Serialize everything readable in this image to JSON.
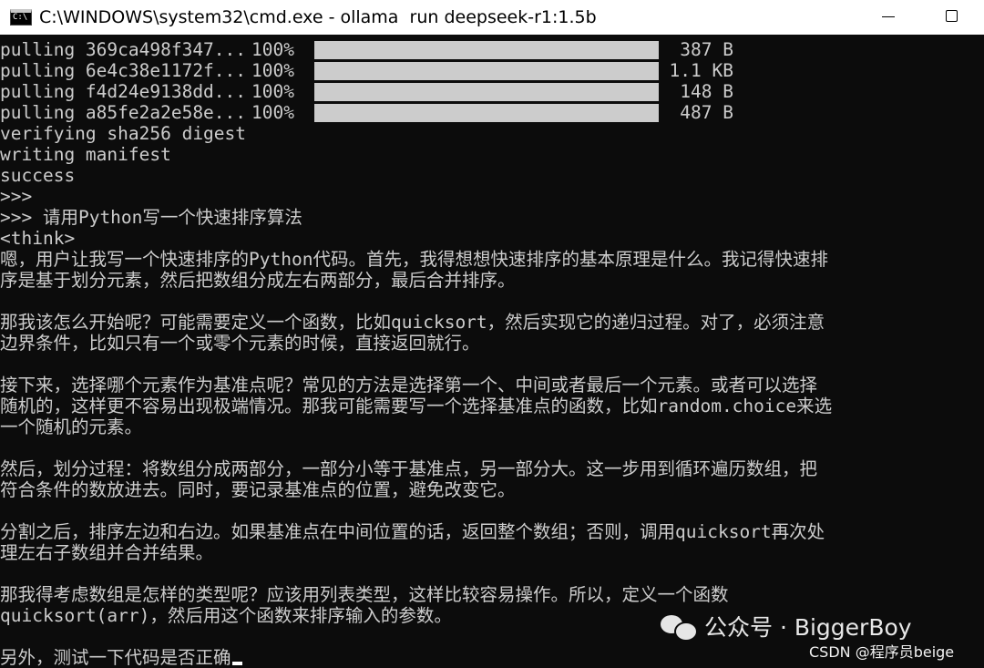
{
  "window": {
    "title": "C:\\WINDOWS\\system32\\cmd.exe - ollama  run deepseek-r1:1.5b",
    "icon": "cmd-icon",
    "icon_text": "C:\\"
  },
  "console": {
    "pull_lines": [
      {
        "label": "pulling 369ca498f347...",
        "percent_text": "100%",
        "progress": 1.0,
        "size": "387 B"
      },
      {
        "label": "pulling 6e4c38e1172f...",
        "percent_text": "100%",
        "progress": 1.0,
        "size": "1.1 KB"
      },
      {
        "label": "pulling f4d24e9138dd...",
        "percent_text": "100%",
        "progress": 1.0,
        "size": "148 B"
      },
      {
        "label": "pulling a85fe2a2e58e...",
        "percent_text": "100%",
        "progress": 1.0,
        "size": "487 B"
      }
    ],
    "status_lines": [
      "verifying sha256 digest",
      "writing manifest",
      "success",
      ">>>"
    ],
    "prompt": ">>> 请用Python写一个快速排序算法",
    "think_tag": "<think>",
    "output_lines": [
      "嗯，用户让我写一个快速排序的Python代码。首先，我得想想快速排序的基本原理是什么。我记得快速排",
      "序是基于划分元素，然后把数组分成左右两部分，最后合并排序。",
      "",
      "那我该怎么开始呢？可能需要定义一个函数，比如quicksort，然后实现它的递归过程。对了，必须注意",
      "边界条件，比如只有一个或零个元素的时候，直接返回就行。",
      "",
      "接下来，选择哪个元素作为基准点呢？常见的方法是选择第一个、中间或者最后一个元素。或者可以选择",
      "随机的，这样更不容易出现极端情况。那我可能需要写一个选择基准点的函数，比如random.choice来选",
      "一个随机的元素。",
      "",
      "然后，划分过程：将数组分成两部分，一部分小等于基准点，另一部分大。这一步用到循环遍历数组，把",
      "符合条件的数放进去。同时，要记录基准点的位置，避免改变它。",
      "",
      "分割之后，排序左边和右边。如果基准点在中间位置的话，返回整个数组；否则，调用quicksort再次处",
      "理左右子数组并合并结果。",
      "",
      "那我得考虑数组是怎样的类型呢？应该用列表类型，这样比较容易操作。所以，定义一个函数",
      "quicksort(arr)，然后用这个函数来排序输入的参数。",
      "",
      "另外，测试一下代码是否正确"
    ]
  },
  "watermark": {
    "text": "公众号 · BiggerBoy",
    "icon": "wechat-icon"
  },
  "credit": {
    "text": "CSDN @程序员beige"
  },
  "colors": {
    "background": "#0c0c0c",
    "text": "#cccccc",
    "titlebar": "#ffffff",
    "progress": "#cccccc"
  }
}
